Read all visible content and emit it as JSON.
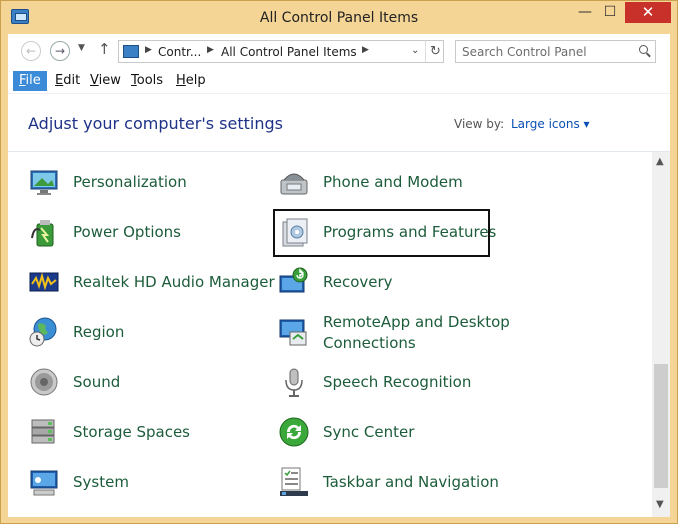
{
  "window": {
    "title": "All Control Panel Items",
    "controls": {
      "minimize": "—",
      "maximize": "☐",
      "close": "✕"
    }
  },
  "address": {
    "crumbs": [
      "Contr...",
      "All Control Panel Items"
    ],
    "search_placeholder": "Search Control Panel"
  },
  "menu": [
    {
      "label": "File",
      "key": "F",
      "rest": "ile"
    },
    {
      "label": "Edit",
      "key": "E",
      "rest": "dit"
    },
    {
      "label": "View",
      "key": "V",
      "rest": "iew"
    },
    {
      "label": "Tools",
      "key": "T",
      "rest": "ools"
    },
    {
      "label": "Help",
      "key": "H",
      "rest": "elp"
    }
  ],
  "content": {
    "heading": "Adjust your computer's settings",
    "view_by_label": "View by:",
    "view_by_value": "Large icons"
  },
  "items_left": [
    {
      "label": "Personalization",
      "icon": "personalization-icon"
    },
    {
      "label": "Power Options",
      "icon": "power-options-icon"
    },
    {
      "label": "Realtek HD Audio Manager",
      "icon": "realtek-audio-icon"
    },
    {
      "label": "Region",
      "icon": "region-icon"
    },
    {
      "label": "Sound",
      "icon": "sound-icon"
    },
    {
      "label": "Storage Spaces",
      "icon": "storage-spaces-icon"
    },
    {
      "label": "System",
      "icon": "system-icon"
    }
  ],
  "items_right": [
    {
      "label": "Phone and Modem",
      "icon": "phone-modem-icon"
    },
    {
      "label": "Programs and Features",
      "icon": "programs-features-icon"
    },
    {
      "label": "Recovery",
      "icon": "recovery-icon"
    },
    {
      "label": "RemoteApp and Desktop Connections",
      "icon": "remoteapp-icon"
    },
    {
      "label": "Speech Recognition",
      "icon": "speech-recognition-icon"
    },
    {
      "label": "Sync Center",
      "icon": "sync-center-icon"
    },
    {
      "label": "Taskbar and Navigation",
      "icon": "taskbar-navigation-icon"
    }
  ],
  "colors": {
    "frame": "#f5d596",
    "item_text": "#1c5c3a",
    "heading_text": "#1e3287",
    "menu_active": "#3c8bd9",
    "close_button": "#c7312a"
  }
}
